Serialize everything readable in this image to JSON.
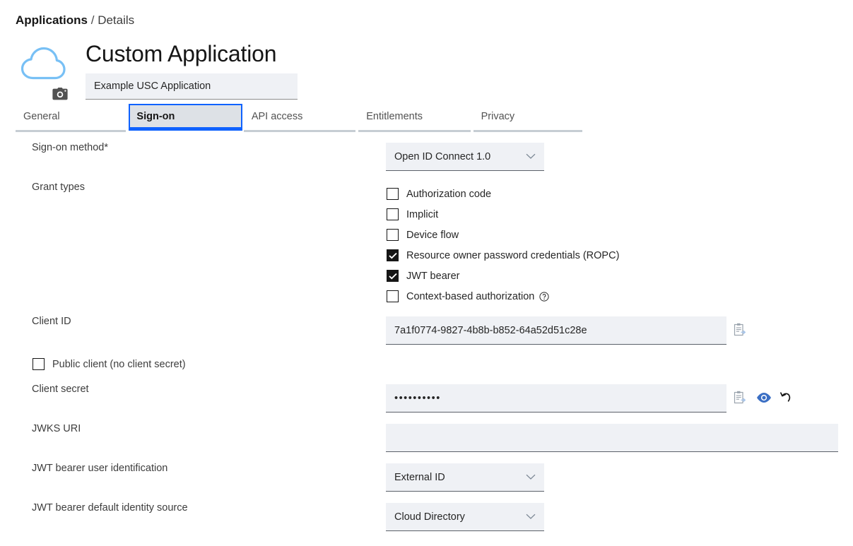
{
  "breadcrumb": {
    "root": "Applications",
    "separator": " / ",
    "leaf": "Details"
  },
  "header": {
    "title": "Custom Application",
    "logo_icon": "cloud-icon",
    "logo_color": "#78c0f5",
    "camera_icon": "camera-icon",
    "app_name_value": "Example USC Application",
    "app_name_placeholder": "Application name"
  },
  "tabs": [
    {
      "label": "General",
      "name": "tab-general",
      "selected": false
    },
    {
      "label": "Sign-on",
      "name": "tab-sign-on",
      "selected": true
    },
    {
      "label": "API access",
      "name": "tab-api-access",
      "selected": false
    },
    {
      "label": "Entitlements",
      "name": "tab-entitlements",
      "selected": false
    },
    {
      "label": "Privacy",
      "name": "tab-privacy",
      "selected": false
    }
  ],
  "form": {
    "sign_on_method": {
      "label": "Sign-on method*",
      "value": "Open ID Connect 1.0"
    },
    "grant_types": {
      "label": "Grant types",
      "items": [
        {
          "label": "Authorization code",
          "checked": false
        },
        {
          "label": "Implicit",
          "checked": false
        },
        {
          "label": "Device flow",
          "checked": false
        },
        {
          "label": "Resource owner password credentials (ROPC)",
          "checked": true
        },
        {
          "label": "JWT bearer",
          "checked": true
        },
        {
          "label": "Context-based authorization",
          "checked": false,
          "help_icon": "help-circle-icon"
        }
      ]
    },
    "client_id": {
      "label": "Client ID",
      "value": "7a1f0774-9827-4b8b-b852-64a52d51c28e",
      "copy_icon": "copy-to-clipboard-icon"
    },
    "public_client": {
      "label": "Public client (no client secret)",
      "checked": false
    },
    "client_secret": {
      "label": "Client secret",
      "value": "••••••••••",
      "copy_icon": "copy-to-clipboard-icon",
      "show_icon": "eye-icon",
      "reset_icon": "undo-arrow-icon"
    },
    "jwks_uri": {
      "label": "JWKS URI",
      "value": "",
      "placeholder": ""
    },
    "jwt_bearer_user_identification": {
      "label": "JWT bearer user identification",
      "value": "External ID"
    },
    "jwt_bearer_default_identity_source": {
      "label": "JWT bearer default identity source",
      "value": "Cloud Directory"
    }
  },
  "colors": {
    "accent_blue": "#0f62fe",
    "field_bg": "#eff1f5",
    "tab_selected_bg": "#dde1e6",
    "eye_blue": "#3b6fc4"
  }
}
